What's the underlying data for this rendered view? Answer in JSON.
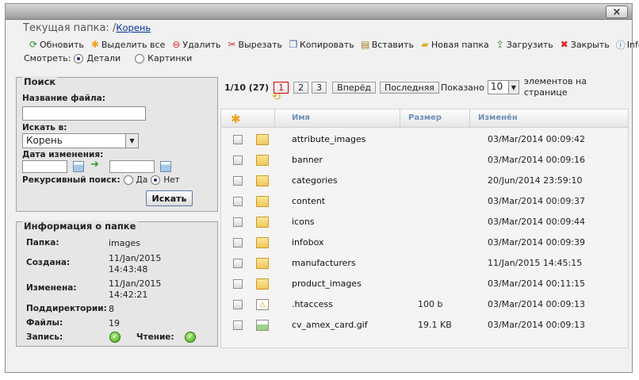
{
  "window": {
    "close_label": "×"
  },
  "location": {
    "label": "Текущая папка: /",
    "path": "Корень"
  },
  "toolbar": [
    {
      "label": "Обновить",
      "icon": "refresh-icon"
    },
    {
      "label": "Выделить все",
      "icon": "select-all-icon"
    },
    {
      "label": "Удалить",
      "icon": "delete-icon"
    },
    {
      "label": "Вырезать",
      "icon": "cut-icon"
    },
    {
      "label": "Копировать",
      "icon": "copy-icon"
    },
    {
      "label": "Вставить",
      "icon": "paste-icon"
    },
    {
      "label": "Новая папка",
      "icon": "new-folder-icon"
    },
    {
      "label": "Загрузить",
      "icon": "upload-icon"
    },
    {
      "label": "Закрыть",
      "icon": "close-icon"
    },
    {
      "label": "Info",
      "icon": "info-icon"
    }
  ],
  "view": {
    "label": "Смотреть:",
    "details": "Детали",
    "thumbnails": "Картинки",
    "selected": "details"
  },
  "search": {
    "title": "Поиск",
    "filename_label": "Название файла:",
    "filename_value": "",
    "search_in_label": "Искать в:",
    "search_in_value": "Корень",
    "date_label": "Дата изменения:",
    "recursive_label": "Рекурсивный поиск:",
    "yes": "Да",
    "no": "Нет",
    "recursive_selected": "no",
    "button": "Искать"
  },
  "folder_info": {
    "title": "Информация о папке",
    "folder_label": "Папка:",
    "folder_value": "images",
    "created_label": "Создана:",
    "created_date": "11/Jan/2015",
    "created_time": "14:43:48",
    "modified_label": "Изменена:",
    "modified_date": "11/Jan/2015",
    "modified_time": "14:42:21",
    "subdirs_label": "Поддиректории:",
    "subdirs_value": "8",
    "files_label": "Файлы:",
    "files_value": "19",
    "write_label": "Запись:",
    "read_label": "Чтение:"
  },
  "pager": {
    "status": "1/10 (27)",
    "pages": [
      "1",
      "2",
      "3"
    ],
    "active_page": "1",
    "next": "Вперёд",
    "last": "Последняя",
    "show_label": "Показано",
    "per_page": "10",
    "per_page_suffix": "элементов на странице"
  },
  "table": {
    "headers": {
      "name": "Имя",
      "size": "Размер",
      "modified": "Изменён"
    },
    "rows": [
      {
        "name": "attribute_images",
        "size": "",
        "modified": "03/Mar/2014 00:09:42",
        "type": "folder"
      },
      {
        "name": "banner",
        "size": "",
        "modified": "03/Mar/2014 00:09:16",
        "type": "folder"
      },
      {
        "name": "categories",
        "size": "",
        "modified": "20/Jun/2014 23:59:10",
        "type": "folder"
      },
      {
        "name": "content",
        "size": "",
        "modified": "03/Mar/2014 00:09:37",
        "type": "folder"
      },
      {
        "name": "icons",
        "size": "",
        "modified": "03/Mar/2014 00:09:44",
        "type": "folder"
      },
      {
        "name": "infobox",
        "size": "",
        "modified": "03/Mar/2014 00:09:39",
        "type": "folder"
      },
      {
        "name": "manufacturers",
        "size": "",
        "modified": "11/Jan/2015 14:45:15",
        "type": "folder"
      },
      {
        "name": "product_images",
        "size": "",
        "modified": "03/Mar/2014 00:11:15",
        "type": "folder"
      },
      {
        "name": ".htaccess",
        "size": "100 b",
        "modified": "03/Mar/2014 00:09:13",
        "type": "warning-file"
      },
      {
        "name": "cv_amex_card.gif",
        "size": "19.1 KB",
        "modified": "03/Mar/2014 00:09:13",
        "type": "image-file"
      }
    ]
  }
}
